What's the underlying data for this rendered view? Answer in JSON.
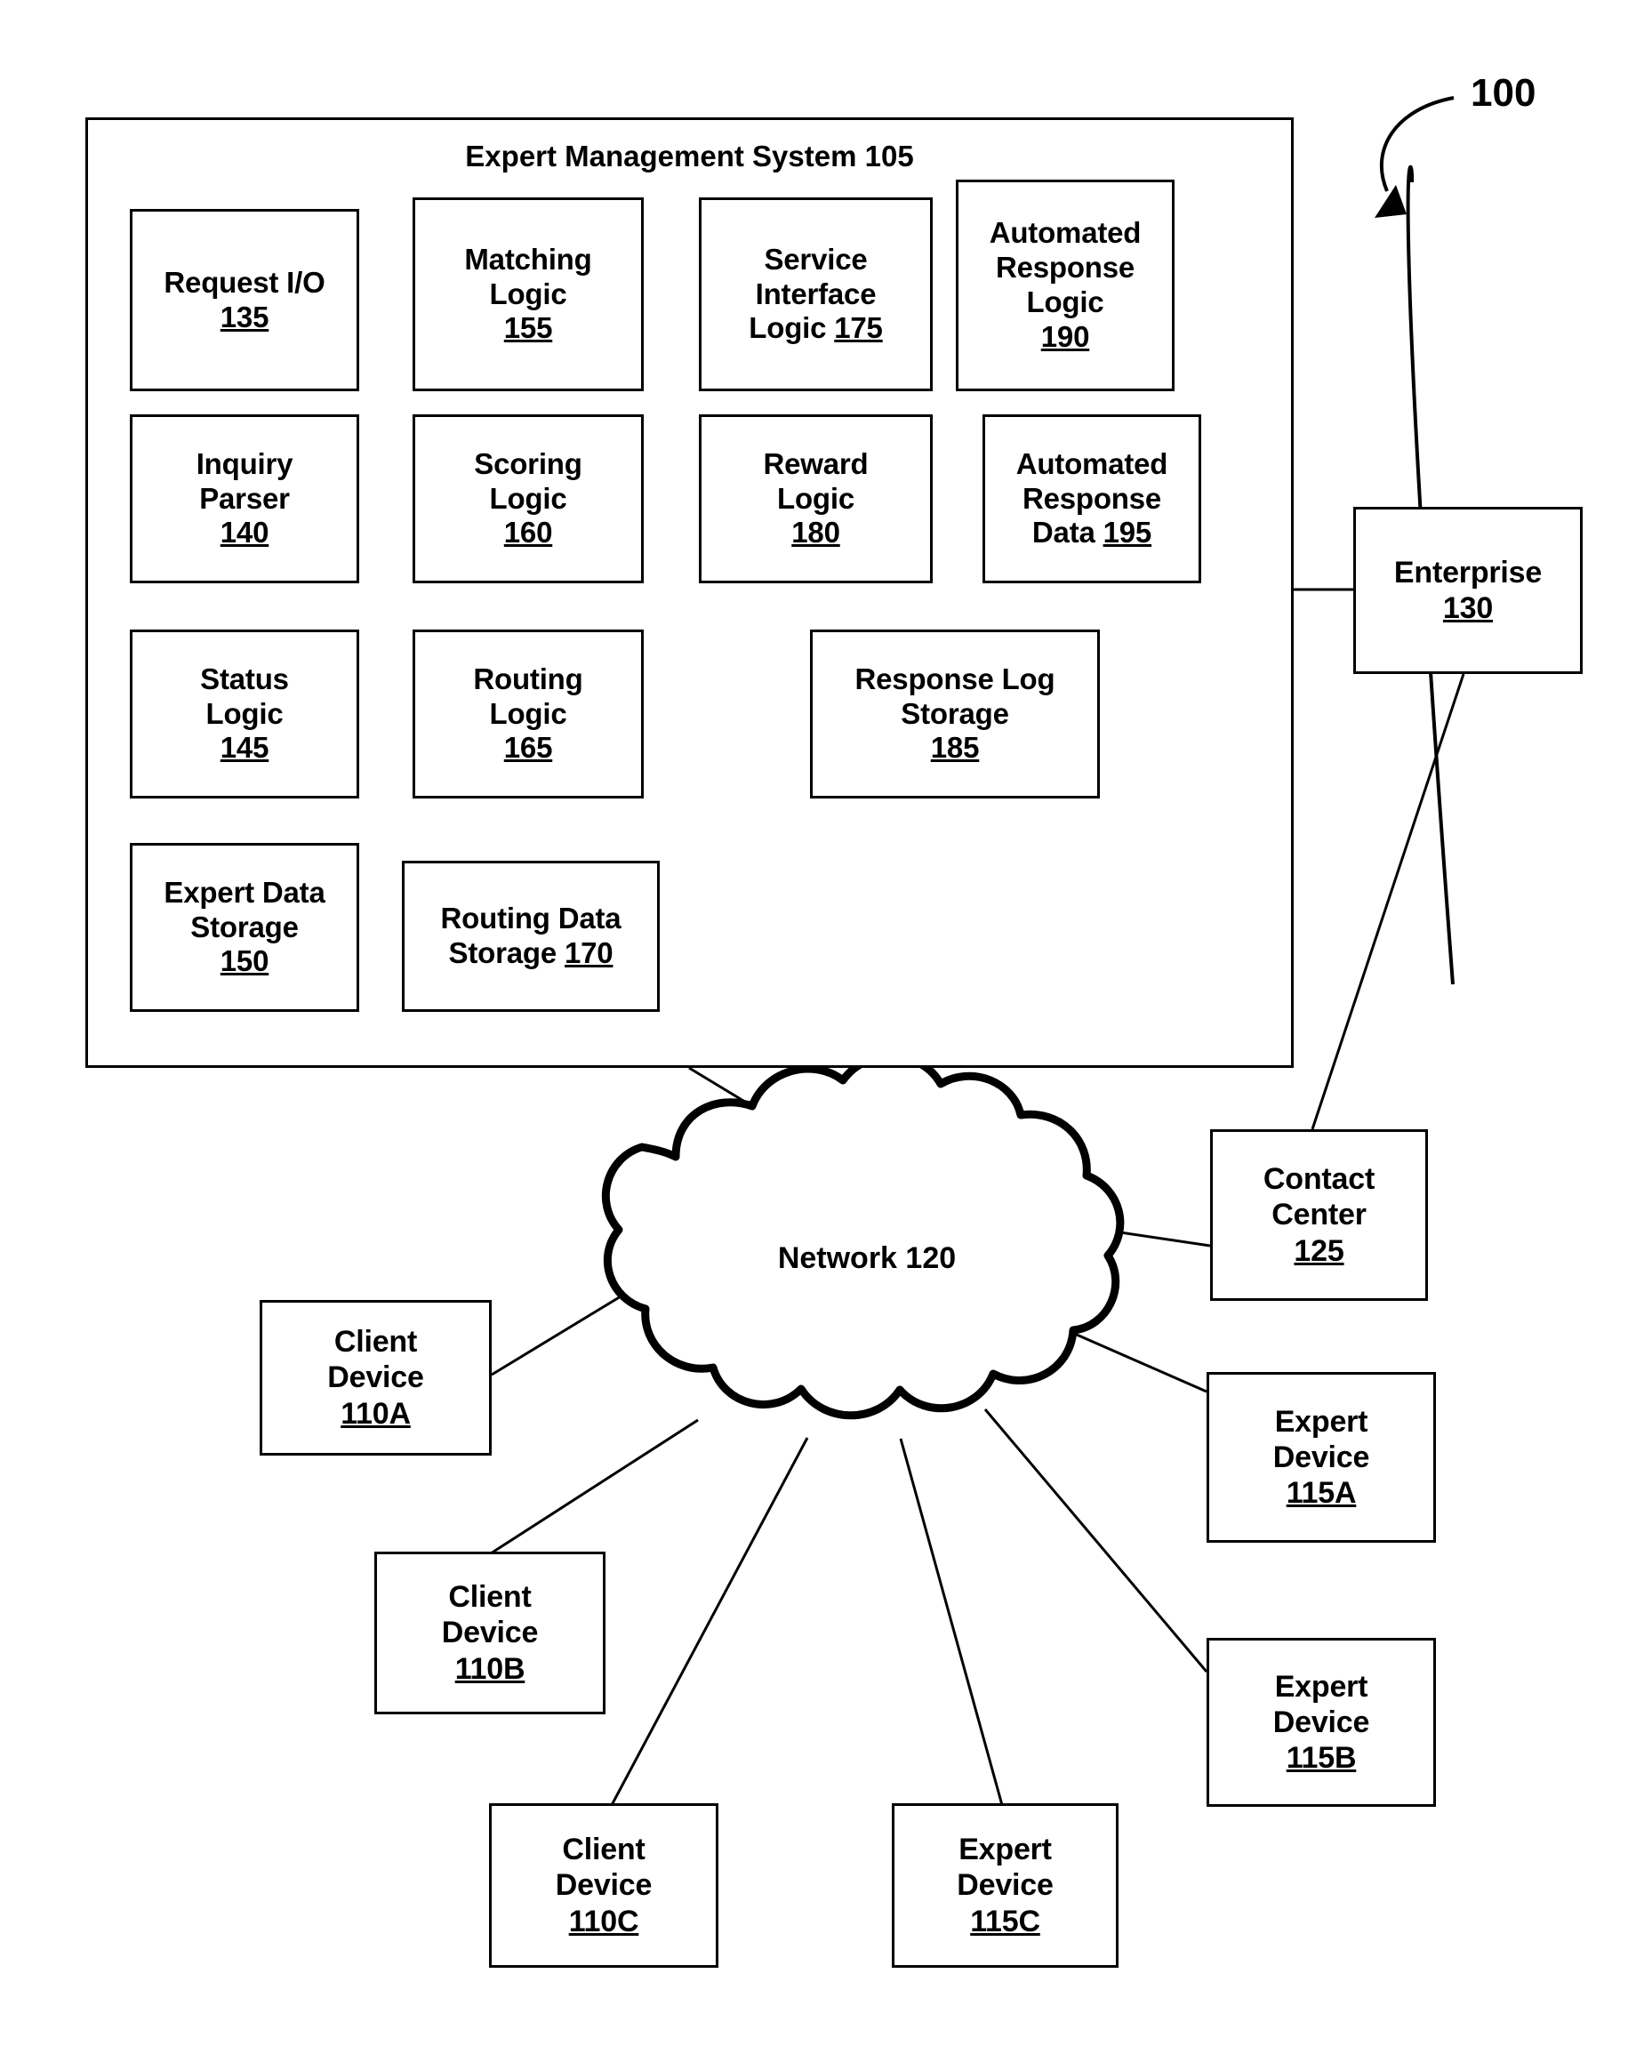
{
  "figure": {
    "number_label": "100"
  },
  "system": {
    "title_text": "Expert Management System",
    "title_ref": "105",
    "modules": [
      {
        "lines": [
          "Request I/O"
        ],
        "ref": "135",
        "ref_inline": false
      },
      {
        "lines": [
          "Matching",
          "Logic"
        ],
        "ref": "155",
        "ref_inline": false
      },
      {
        "lines": [
          "Service",
          "Interface"
        ],
        "ref": "175",
        "ref_inline": true,
        "inline_prefix": "Logic"
      },
      {
        "lines": [
          "Automated",
          "Response",
          "Logic"
        ],
        "ref": "190",
        "ref_inline": false
      },
      {
        "lines": [
          "Inquiry",
          "Parser"
        ],
        "ref": "140",
        "ref_inline": false
      },
      {
        "lines": [
          "Scoring",
          "Logic"
        ],
        "ref": "160",
        "ref_inline": false
      },
      {
        "lines": [
          "Reward",
          "Logic"
        ],
        "ref": "180",
        "ref_inline": false
      },
      {
        "lines": [
          "Automated",
          "Response"
        ],
        "ref": "195",
        "ref_inline": true,
        "inline_prefix": "Data"
      },
      {
        "lines": [
          "Status",
          "Logic"
        ],
        "ref": "145",
        "ref_inline": false
      },
      {
        "lines": [
          "Routing",
          "Logic"
        ],
        "ref": "165",
        "ref_inline": false
      },
      {
        "lines": [
          "Response Log",
          "Storage"
        ],
        "ref": "185",
        "ref_inline": false
      },
      {
        "lines": [
          "Expert Data",
          "Storage"
        ],
        "ref": "150",
        "ref_inline": false
      },
      {
        "lines": [
          "Routing Data"
        ],
        "ref": "170",
        "ref_inline": true,
        "inline_prefix": "Storage"
      }
    ]
  },
  "entities": {
    "enterprise": {
      "lines": [
        "Enterprise"
      ],
      "ref": "130"
    },
    "contact_center": {
      "lines": [
        "Contact",
        "Center"
      ],
      "ref": "125"
    },
    "network": {
      "label": "Network",
      "ref": "120"
    },
    "client_devices": [
      {
        "lines": [
          "Client",
          "Device"
        ],
        "ref": "110A"
      },
      {
        "lines": [
          "Client",
          "Device"
        ],
        "ref": "110B"
      },
      {
        "lines": [
          "Client",
          "Device"
        ],
        "ref": "110C"
      }
    ],
    "expert_devices": [
      {
        "lines": [
          "Expert",
          "Device"
        ],
        "ref": "115A"
      },
      {
        "lines": [
          "Expert",
          "Device"
        ],
        "ref": "115B"
      },
      {
        "lines": [
          "Expert",
          "Device"
        ],
        "ref": "115C"
      }
    ]
  },
  "colors": {
    "stroke": "#000000",
    "fill": "#ffffff"
  }
}
